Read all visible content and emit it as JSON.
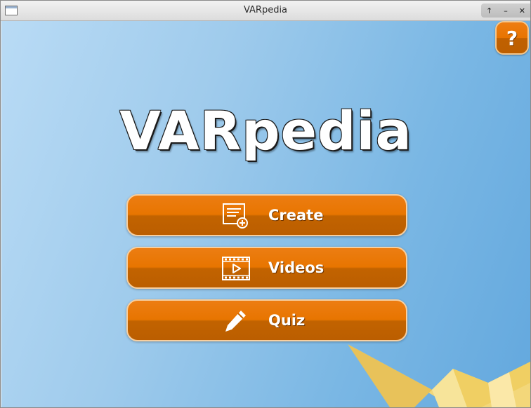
{
  "window": {
    "title": "VARpedia"
  },
  "window_controls": {
    "maximize": "↑",
    "minimize": "–",
    "close": "✕"
  },
  "help": {
    "label": "?"
  },
  "logo": {
    "text": "VARpedia"
  },
  "menu": [
    {
      "label": "Create",
      "icon": "create-document-icon"
    },
    {
      "label": "Videos",
      "icon": "video-film-icon"
    },
    {
      "label": "Quiz",
      "icon": "pencil-icon"
    }
  ],
  "colors": {
    "accent": "#e87500",
    "accent_dark": "#bb5e00",
    "background": "#7ab7e4"
  }
}
